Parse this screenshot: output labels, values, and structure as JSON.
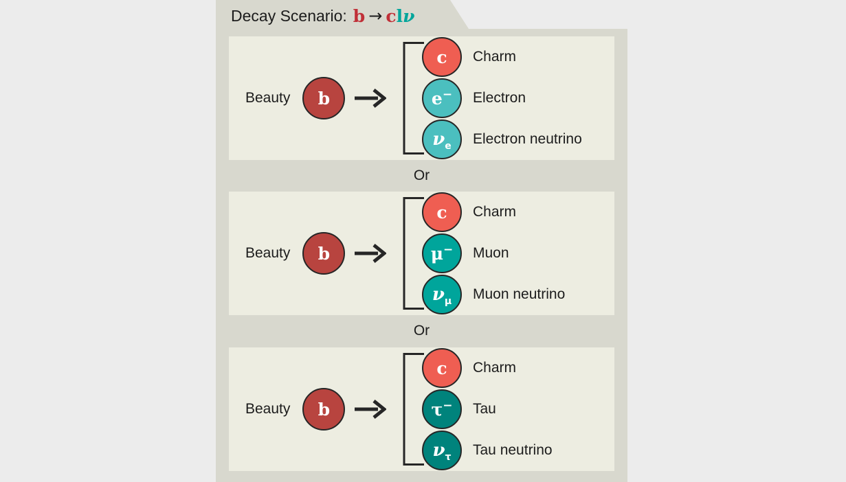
{
  "title": {
    "prefix": "Decay Scenario:",
    "equation": {
      "parent": "b",
      "arrow": "→",
      "charm": "c",
      "lepton": "l",
      "neutrino": "ν"
    }
  },
  "separator_label": "Or",
  "colors": {
    "page_background": "#ECECEC",
    "folder_background": "#D8D8CE",
    "panel_background": "#EDEDE1",
    "beauty": "#B8443F",
    "charm": "#EF5E52",
    "electron": "#4BBFBF",
    "muon": "#00A59B",
    "tau": "#00837C",
    "text": "#1C1C1C",
    "title_quark": "#C03038",
    "title_lepton": "#00A59B"
  },
  "scenarios": [
    {
      "parent_label": "Beauty",
      "parent_symbol": "b",
      "products": [
        {
          "symbol": "c",
          "sup": "",
          "sub": "",
          "name": "Charm",
          "color": "#EF5E52",
          "italic": false
        },
        {
          "symbol": "e",
          "sup": "−",
          "sub": "",
          "name": "Electron",
          "color": "#4BBFBF",
          "italic": false
        },
        {
          "symbol": "ν",
          "sup": "",
          "sub": "e",
          "name": "Electron neutrino",
          "color": "#4BBFBF",
          "italic": true
        }
      ]
    },
    {
      "parent_label": "Beauty",
      "parent_symbol": "b",
      "products": [
        {
          "symbol": "c",
          "sup": "",
          "sub": "",
          "name": "Charm",
          "color": "#EF5E52",
          "italic": false
        },
        {
          "symbol": "μ",
          "sup": "−",
          "sub": "",
          "name": "Muon",
          "color": "#00A59B",
          "italic": false
        },
        {
          "symbol": "ν",
          "sup": "",
          "sub": "μ",
          "name": "Muon neutrino",
          "color": "#00A59B",
          "italic": true
        }
      ]
    },
    {
      "parent_label": "Beauty",
      "parent_symbol": "b",
      "products": [
        {
          "symbol": "c",
          "sup": "",
          "sub": "",
          "name": "Charm",
          "color": "#EF5E52",
          "italic": false
        },
        {
          "symbol": "τ",
          "sup": "−",
          "sub": "",
          "name": "Tau",
          "color": "#00837C",
          "italic": false
        },
        {
          "symbol": "ν",
          "sup": "",
          "sub": "τ",
          "name": "Tau neutrino",
          "color": "#00837C",
          "italic": true
        }
      ]
    }
  ]
}
